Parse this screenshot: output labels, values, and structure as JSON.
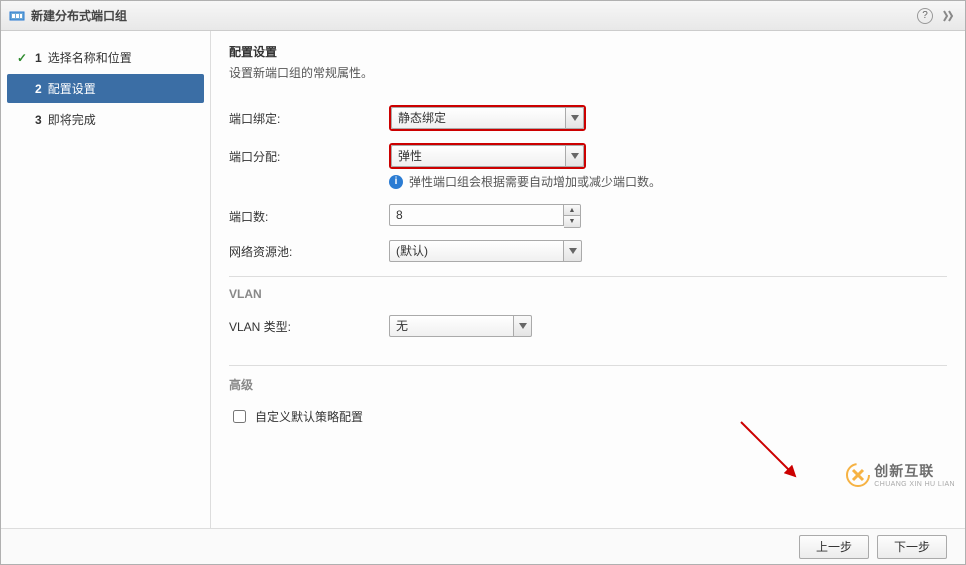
{
  "window": {
    "title": "新建分布式端口组"
  },
  "steps": {
    "s1": {
      "num": "1",
      "label": "选择名称和位置"
    },
    "s2": {
      "num": "2",
      "label": "配置设置"
    },
    "s3": {
      "num": "3",
      "label": "即将完成"
    }
  },
  "content": {
    "heading": "配置设置",
    "subheading": "设置新端口组的常规属性。",
    "port_binding_label": "端口绑定:",
    "port_binding_value": "静态绑定",
    "port_alloc_label": "端口分配:",
    "port_alloc_value": "弹性",
    "info_text": "弹性端口组会根据需要自动增加或减少端口数。",
    "port_count_label": "端口数:",
    "port_count_value": "8",
    "resource_pool_label": "网络资源池:",
    "resource_pool_value": "(默认)",
    "vlan_section": "VLAN",
    "vlan_type_label": "VLAN 类型:",
    "vlan_type_value": "无",
    "advanced_section": "高级",
    "custom_policy_label": "自定义默认策略配置"
  },
  "footer": {
    "back": "上一步",
    "next": "下一步"
  },
  "watermark": {
    "main": "创新互联",
    "sub": "CHUANG XIN HU LIAN"
  }
}
